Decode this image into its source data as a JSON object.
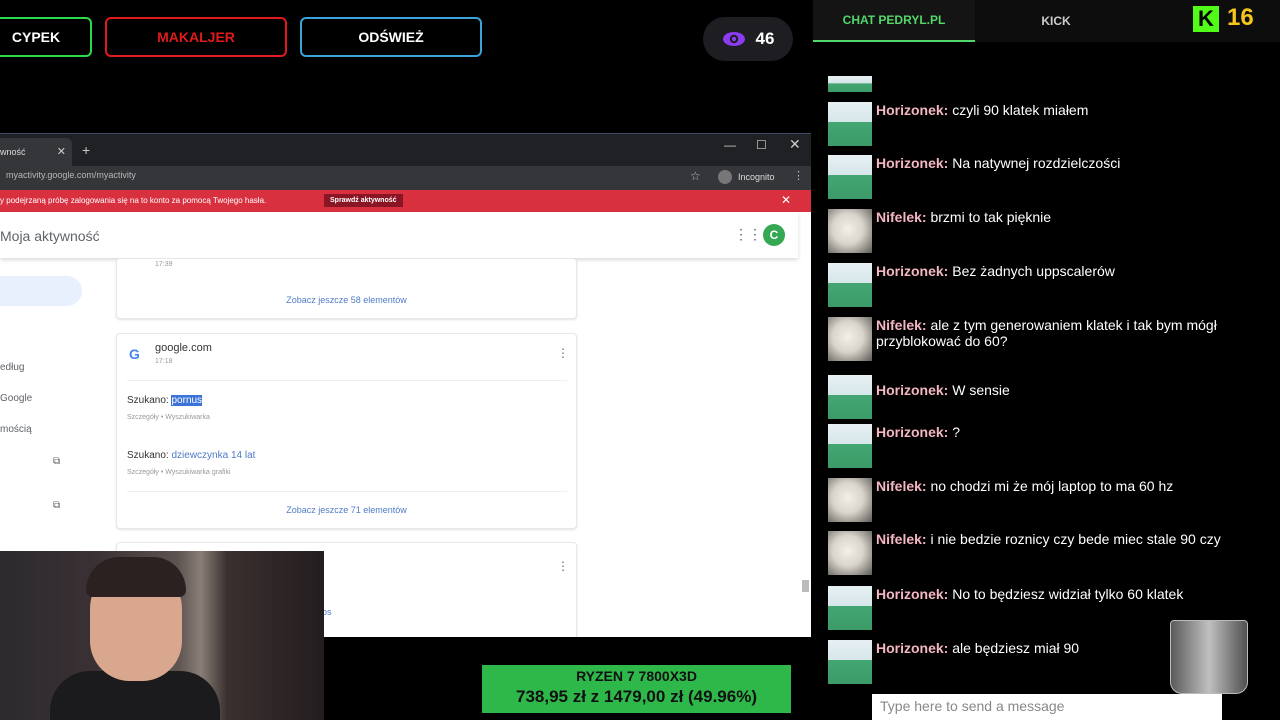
{
  "overlay": {
    "buttons": [
      "CYPEK",
      "MAKALJER",
      "ODŚWIEŻ"
    ],
    "viewers": "46",
    "colors": {
      "green": "#2bd94a",
      "red": "#e01a1a",
      "blue": "#3aa3d8"
    }
  },
  "browser": {
    "tab_title": "wność",
    "url": "myactivity.google.com/myactivity",
    "incognito_label": "Incognito",
    "alert_text": "y podejrzaną próbę zalogowania się na to konto za pomocą Twojego hasła.",
    "alert_button": "Sprawdź aktywność",
    "page_title": "Moja aktywność",
    "avatar_letter": "C",
    "sidebar": [
      "edług",
      "Google",
      "mością"
    ],
    "top_card": {
      "time": "17:39",
      "more_link": "Zobacz jeszcze 58 elementów"
    },
    "card": {
      "domain": "google.com",
      "time": "17:18",
      "entries": [
        {
          "prefix": "Szukano: ",
          "query": "pornus",
          "details": "Szczegóły • Wyszukiwarka"
        },
        {
          "prefix": "Szukano: ",
          "query": "dziewczynka 14 lat",
          "details": "Szczegóły • Wyszukiwarka grafiki"
        }
      ],
      "more_link": "Zobacz jeszcze 71 elementów"
    },
    "bottom_card_fragment": "os"
  },
  "sale": {
    "line1": "RYZEN 7 7800X3D",
    "line2": "738,95 zł z 1479,00 zł (49.96%)"
  },
  "chat": {
    "tabs": [
      "CHAT PEDRYL.PL",
      "KICK"
    ],
    "kick_logo": "K",
    "kick_count": "16",
    "messages": [
      {
        "user": "Horizonek:",
        "text": " czyli 90 klatek miałem",
        "avatar": "horizonek"
      },
      {
        "user": "Horizonek:",
        "text": " Na natywnej rozdzielczości",
        "avatar": "horizonek"
      },
      {
        "user": "Nifelek:",
        "text": " brzmi to tak pięknie",
        "avatar": "nifelek"
      },
      {
        "user": "Horizonek:",
        "text": " Bez żadnych uppscalerów",
        "avatar": "horizonek"
      },
      {
        "user": "Nifelek:",
        "text": " ale z tym generowaniem klatek i tak bym mógł przyblokować do 60?",
        "avatar": "nifelek"
      },
      {
        "user": "Horizonek:",
        "text": " W sensie",
        "avatar": "horizonek"
      },
      {
        "user": "Horizonek:",
        "text": " ?",
        "avatar": "horizonek"
      },
      {
        "user": "Nifelek:",
        "text": " no chodzi mi że mój laptop to ma 60 hz",
        "avatar": "nifelek"
      },
      {
        "user": "Nifelek:",
        "text": " i nie bedzie roznicy czy bede miec stale 90 czy",
        "avatar": "nifelek"
      },
      {
        "user": "Horizonek:",
        "text": " No to będziesz widział tylko 60 klatek",
        "avatar": "horizonek"
      },
      {
        "user": "Horizonek:",
        "text": " ale będziesz miał 90",
        "avatar": "horizonek"
      }
    ],
    "input_placeholder": "Type here to send a message"
  }
}
